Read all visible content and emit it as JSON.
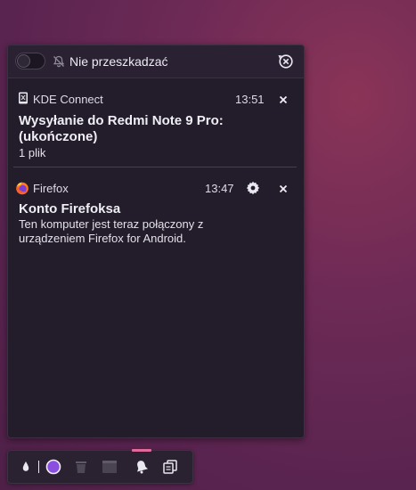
{
  "dnd": {
    "label": "Nie przeszkadzać",
    "toggle_on": false
  },
  "notifications": [
    {
      "app": "KDE Connect",
      "time": "13:51",
      "title": "Wysyłanie do Redmi Note 9 Pro: (ukończone)",
      "title_line1": "Wysyłanie do Redmi Note 9 Pro:",
      "title_line2": "(ukończone)",
      "body": "1 plik",
      "icon": "kde-connect-icon"
    },
    {
      "app": "Firefox",
      "time": "13:47",
      "title": "Konto Firefoksa",
      "body_line1": "Ten komputer jest teraz połączony z",
      "body_line2": "urządzeniem Firefox for Android.",
      "icon": "firefox-icon"
    }
  ],
  "taskbar": {
    "items": [
      "water-drop-icon",
      "color-picker-icon",
      "trash-icon",
      "window-icon",
      "notification-bell-icon",
      "clipboard-icon"
    ],
    "accent": "#e06a9a",
    "picker_color": "#8a4ee0"
  },
  "colors": {
    "panel_bg": "#231c2b",
    "desktop": "#6e2a56"
  }
}
